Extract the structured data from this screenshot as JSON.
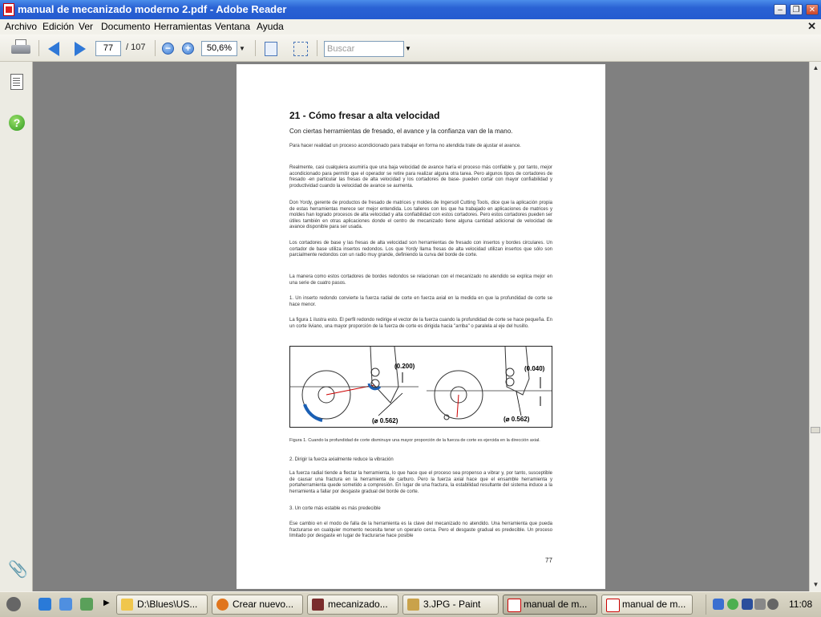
{
  "window": {
    "title": "manual de mecanizado moderno 2.pdf - Adobe Reader"
  },
  "menu": {
    "items": [
      "Archivo",
      "Edición",
      "Ver",
      "Documento",
      "Herramientas",
      "Ventana",
      "Ayuda"
    ]
  },
  "toolbar": {
    "page_current": "77",
    "page_total": "/ 107",
    "zoom": "50,6%",
    "search_placeholder": "Buscar",
    "icons": [
      "printer-icon",
      "prev-page-icon",
      "next-page-icon",
      "zoom-out-icon",
      "zoom-in-icon",
      "fit-page-icon",
      "fit-width-icon"
    ]
  },
  "sidebar": {
    "icons": [
      "pages-icon",
      "help-icon",
      "attachment-icon"
    ]
  },
  "document": {
    "title": "21 - Cómo fresar a alta velocidad",
    "subtitle": "Con ciertas herramientas de fresado, el avance y la confianza van de la mano.",
    "paragraphs": [
      "Para hacer realidad un proceso acondicionado para trabajar en forma no atendida trate de ajustar el avance.",
      "Realmente, casi cualquiera asumiría que una baja velocidad de avance haría el proceso más confiable y, por tanto, mejor acondicionado para permitir que el operador se retire para realizar alguna otra tarea. Pero algunos tipos de cortadores de fresado -en particular las fresas de alta velocidad y los cortadores de base- pueden cortar con mayor confiabilidad y productividad cuando la velocidad de avance se aumenta.",
      "Don Yordy, gerente de productos de fresado de matrices y moldes de Ingersoll Cutting Tools, dice que la aplicación propia de estas herramientas merece ser mejor entendida. Los talleres con los que ha trabajado en aplicaciones de matrices y moldes han logrado procesos de alta velocidad y alta confiabilidad con estos cortadores. Pero estos cortadores pueden ser útiles también en otras aplicaciones donde el centro de mecanizado tiene alguna cantidad adicional de velocidad de avance disponible para ser usada.",
      "Los cortadores de base y las fresas de alta velocidad son herramientas de fresado con insertos y bordes circulares. Un cortador de base utiliza insertos redondos. Los que Yordy llama fresas de alta velocidad utilizan insertos que sólo son parcialmente redondos con un radio muy grande, definiendo la curva del borde de corte.",
      "La manera como estos cortadores de bordes redondos se relacionan con el mecanizado no atendido se explica mejor en una serie de cuatro pasos.",
      "1. Un inserto redondo convierte la fuerza radial de corte en fuerza axial en la medida en que la profundidad de corte se hace menor.",
      "La figura 1 ilustra esto. El perfil redondo redirige el vector de la fuerza cuando la profundidad de corte se hace pequeña. En un corte liviano, una mayor proporción de la fuerza de corte es dirigida hacia \"arriba\" o paralela al eje del husillo."
    ],
    "figure_labels": {
      "depth_a": "(0.200)",
      "dia_a": "(⌀ 0.562)",
      "depth_b": "(0.040)",
      "dia_b": "(⌀ 0.562)"
    },
    "caption": "Figura 1. Cuando la profundidad de corte disminuye una mayor proporción de la fuerza de corte es ejercida en la dirección axial.",
    "after": [
      "2. Dirigir la fuerza axialmente reduce la vibración",
      "La fuerza radial tiende a flectar la herramienta, lo que hace que el proceso sea propenso a vibrar y, por tanto, susceptible de causar una fractura en la herramienta de carburo. Pero la fuerza axial hace que el ensamble herramienta y portaherramienta quede sometido a compresión. En lugar de una fractura, la estabilidad resultante del sistema induce a la herramienta a fallar por desgaste gradual del borde de corte.",
      "3. Un corte más estable es más predecible",
      "Ese cambio en el modo de falla de la herramienta es la clave del mecanizado no atendido. Una herramienta que pueda fracturarse en cualquier momento necesita tener un operario cerca. Pero el desgaste gradual es predecible. Un proceso limitado por desgaste en lugar de fracturarse hace posible"
    ],
    "page_number": "77"
  },
  "taskbar": {
    "tasks": [
      "D:\\Blues\\US...",
      "Crear nuevo...",
      "mecanizado...",
      "3.JPG - Paint",
      "manual de m...",
      "manual de m..."
    ],
    "clock": "11:08"
  },
  "colors": {
    "titlebar": "#245bd0",
    "doc_bg": "#808080",
    "accent_arrow": "#2f78d7"
  }
}
